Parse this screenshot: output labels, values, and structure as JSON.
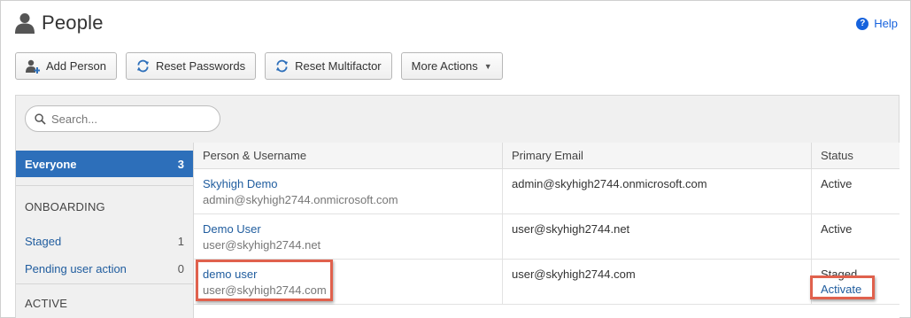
{
  "header": {
    "title": "People",
    "help_label": "Help"
  },
  "toolbar": {
    "add_person": "Add Person",
    "reset_passwords": "Reset Passwords",
    "reset_multifactor": "Reset Multifactor",
    "more_actions": "More Actions"
  },
  "search": {
    "placeholder": "Search..."
  },
  "sidebar": {
    "everyone": {
      "label": "Everyone",
      "count": "3"
    },
    "onboarding_section": "ONBOARDING",
    "staged": {
      "label": "Staged",
      "count": "1"
    },
    "pending": {
      "label": "Pending user action",
      "count": "0"
    },
    "active_section": "ACTIVE"
  },
  "table": {
    "columns": [
      "Person & Username",
      "Primary Email",
      "Status"
    ],
    "rows": [
      {
        "name": "Skyhigh Demo",
        "username": "admin@skyhigh2744.onmicrosoft.com",
        "email": "admin@skyhigh2744.onmicrosoft.com",
        "status": "Active",
        "action": ""
      },
      {
        "name": "Demo User",
        "username": "user@skyhigh2744.net",
        "email": "user@skyhigh2744.net",
        "status": "Active",
        "action": ""
      },
      {
        "name": "demo user",
        "username": "user@skyhigh2744.com",
        "email": "user@skyhigh2744.com",
        "status": "Staged",
        "action": "Activate"
      }
    ]
  },
  "colors": {
    "accent": "#2d6fba",
    "link": "#1f5c9e",
    "highlight": "#e0614d"
  }
}
